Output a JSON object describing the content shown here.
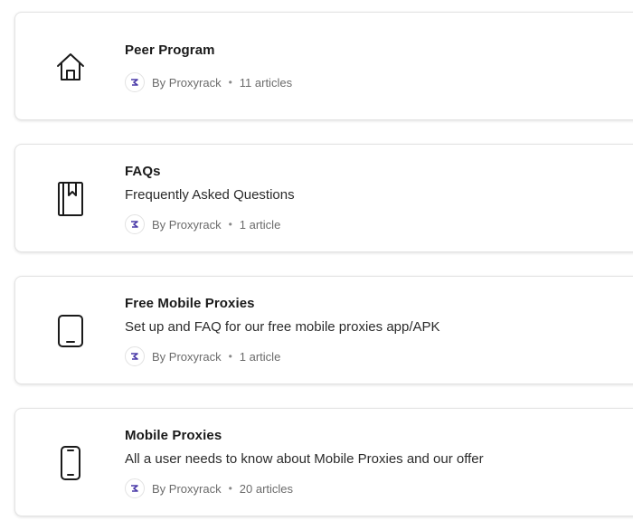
{
  "collections": [
    {
      "title": "Peer Program",
      "description": "",
      "icon": "house-icon",
      "author": "By Proxyrack",
      "count": "11 articles"
    },
    {
      "title": "FAQs",
      "description": "Frequently Asked Questions",
      "icon": "book-bookmark-icon",
      "author": "By Proxyrack",
      "count": "1 article"
    },
    {
      "title": "Free Mobile Proxies",
      "description": "Set up and FAQ for our free mobile proxies app/APK",
      "icon": "tablet-icon",
      "author": "By Proxyrack",
      "count": "1 article"
    },
    {
      "title": "Mobile Proxies",
      "description": "All a user needs to know about Mobile Proxies and our offer",
      "icon": "mobile-phone-icon",
      "author": "By Proxyrack",
      "count": "20 articles"
    }
  ],
  "colors": {
    "avatar_accent": "#4a3aa8",
    "text_primary": "#1a1a1a",
    "text_muted": "#6b6b6b"
  },
  "separator": "•"
}
